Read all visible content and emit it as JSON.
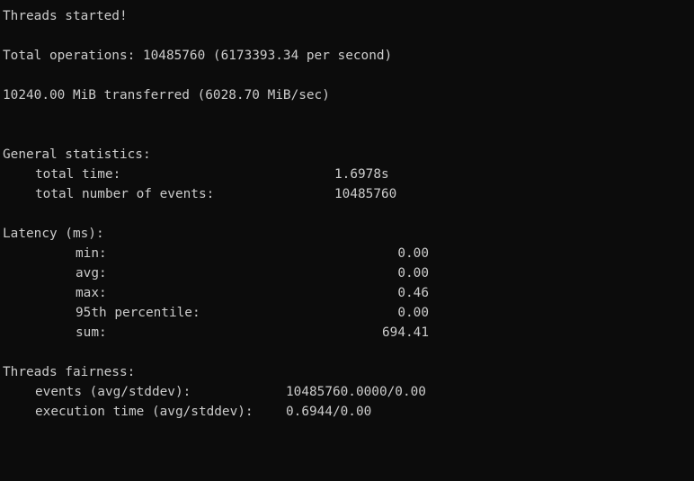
{
  "output": {
    "threads_started": "Threads started!",
    "total_operations": "Total operations: 10485760 (6173393.34 per second)",
    "transferred": "10240.00 MiB transferred (6028.70 MiB/sec)",
    "general": {
      "heading": "General statistics:",
      "total_time_label": "total time:",
      "total_time_value": "1.6978s",
      "total_events_label": "total number of events:",
      "total_events_value": "10485760"
    },
    "latency": {
      "heading": "Latency (ms):",
      "min_label": "min:",
      "min_value": "0.00",
      "avg_label": "avg:",
      "avg_value": "0.00",
      "max_label": "max:",
      "max_value": "0.46",
      "p95_label": "95th percentile:",
      "p95_value": "0.00",
      "sum_label": "sum:",
      "sum_value": "694.41"
    },
    "fairness": {
      "heading": "Threads fairness:",
      "events_label": "events (avg/stddev):",
      "events_value": "10485760.0000/0.00",
      "exec_label": "execution time (avg/stddev):",
      "exec_value": "0.6944/0.00"
    }
  },
  "colors": {
    "background": "#0c0c0c",
    "text": "#cccccc"
  }
}
